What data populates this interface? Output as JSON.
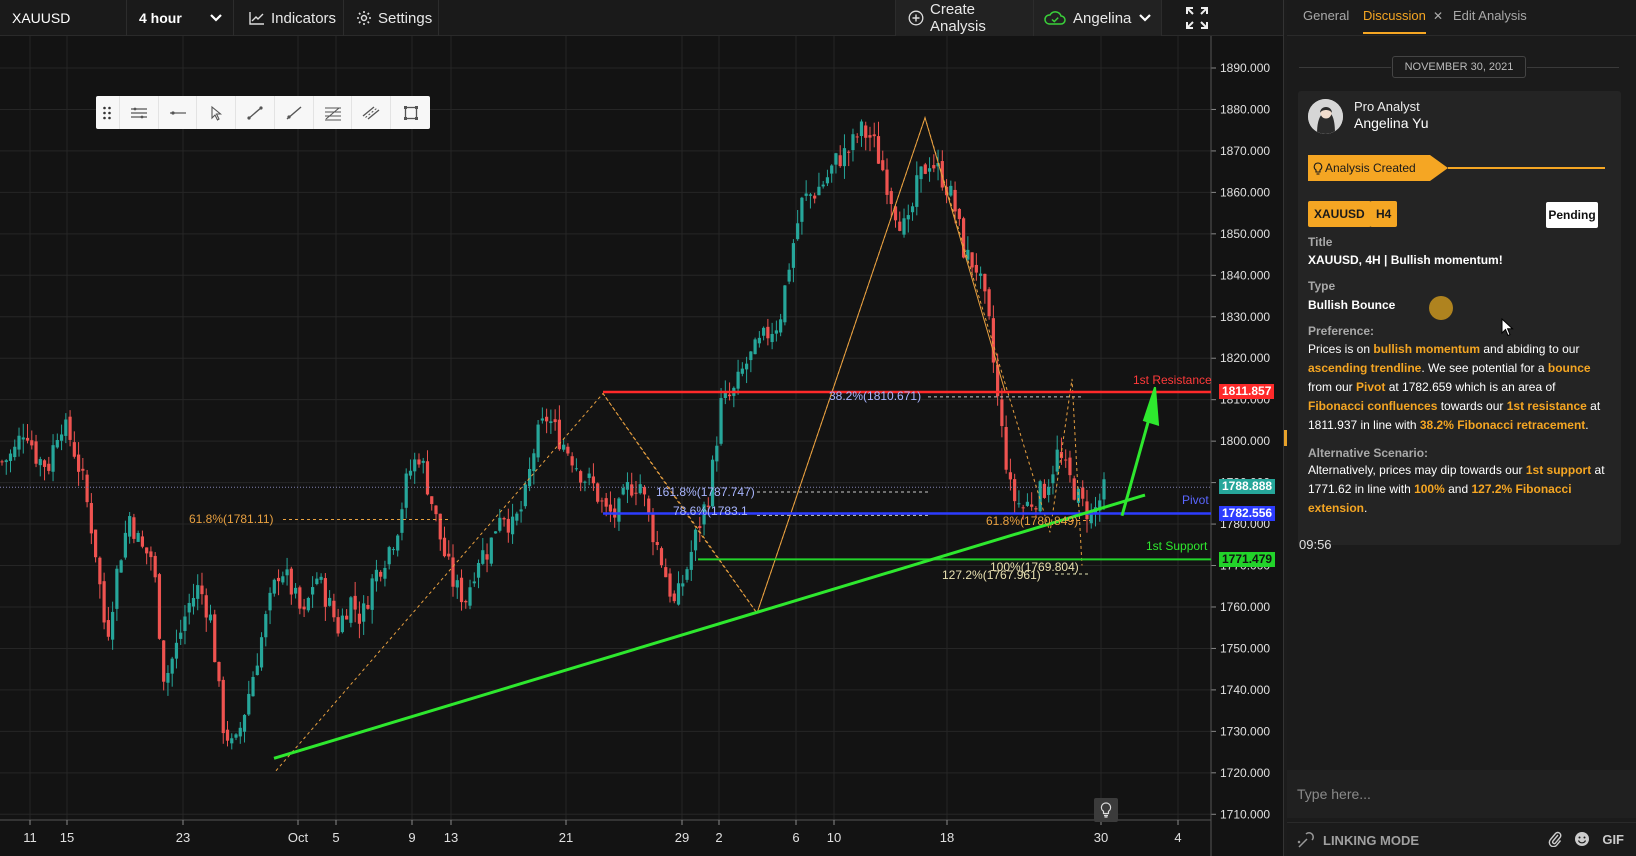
{
  "toolbar": {
    "symbol": "XAUUSD",
    "interval": "4 hour",
    "indicators_label": "Indicators",
    "settings_label": "Settings",
    "create_label": "Create Analysis",
    "user_label": "Angelina"
  },
  "chart_data": {
    "type": "candlestick",
    "symbol": "XAUUSD",
    "timeframe": "4 hour",
    "y_ticks": [
      "1890.000",
      "1880.000",
      "1870.000",
      "1860.000",
      "1850.000",
      "1840.000",
      "1830.000",
      "1820.000",
      "1810.000",
      "1800.000",
      "1790.000",
      "1780.000",
      "1770.000",
      "1760.000",
      "1750.000",
      "1740.000",
      "1730.000",
      "1720.000",
      "1710.000"
    ],
    "x_ticks": [
      "11",
      "15",
      "23",
      "Oct",
      "5",
      "9",
      "13",
      "21",
      "29",
      "2",
      "6",
      "10",
      "18",
      "30",
      "4"
    ],
    "ylim": [
      1706,
      1894
    ],
    "approx_close_path": [
      1795,
      1797,
      1804,
      1796,
      1794,
      1805,
      1800,
      1790,
      1775,
      1752,
      1770,
      1782,
      1774,
      1772,
      1742,
      1750,
      1760,
      1765,
      1757,
      1732,
      1725,
      1736,
      1748,
      1760,
      1770,
      1764,
      1757,
      1768,
      1762,
      1755,
      1762,
      1757,
      1767,
      1772,
      1778,
      1792,
      1797,
      1786,
      1774,
      1765,
      1762,
      1772,
      1774,
      1784,
      1779,
      1785,
      1800,
      1806,
      1801,
      1797,
      1792,
      1789,
      1783,
      1782,
      1789,
      1790,
      1779,
      1770,
      1760,
      1769,
      1779,
      1788,
      1809,
      1811,
      1818,
      1822,
      1826,
      1829,
      1845,
      1858,
      1860,
      1863,
      1868,
      1870,
      1875,
      1873,
      1865,
      1856,
      1850,
      1863,
      1868,
      1864,
      1858,
      1845,
      1842,
      1830,
      1806,
      1787,
      1784,
      1786,
      1789,
      1797,
      1791,
      1785,
      1782,
      1788
    ],
    "levels": [
      {
        "name": "1st Resistance",
        "value": 1811.857,
        "color": "#ff2a2a"
      },
      {
        "name": "Pivot",
        "value": 1782.556,
        "color": "#2d3cff"
      },
      {
        "name": "1st Support",
        "value": 1771.479,
        "color": "#22d32a"
      }
    ],
    "last_price_badge": "1788.888",
    "fib_labels": [
      "38.2%(1810.671)",
      "161.8%(1787.747)",
      "78.6%(1783.1",
      "61.8%(1781.11)",
      "61.8%(1780.849)",
      "100%(1769.804)",
      "127.2%(1767.961)"
    ]
  },
  "panel": {
    "tabs": [
      "General",
      "Discussion",
      "Edit Analysis"
    ],
    "date": "NOVEMBER 30, 2021",
    "role": "Pro Analyst",
    "author": "Angelina Yu",
    "created_label": "Analysis Created",
    "symbol_tag": "XAUUSD",
    "tf_tag": "H4",
    "status": "Pending",
    "title_label": "Title",
    "title_value": "XAUUSD, 4H | Bullish momentum!",
    "type_label": "Type",
    "type_value": "Bullish Bounce",
    "preference_label": "Preference:",
    "alt_label": "Alternative Scenario:",
    "time": "09:56",
    "message_placeholder": "Type here...",
    "linking_mode": "LINKING MODE",
    "gif_label": "GIF"
  },
  "colors": {
    "accent": "#f5a623",
    "bull": "#26a69a",
    "bear": "#ef5350",
    "trendline": "#2ee82e",
    "fib": "#e8a040"
  }
}
